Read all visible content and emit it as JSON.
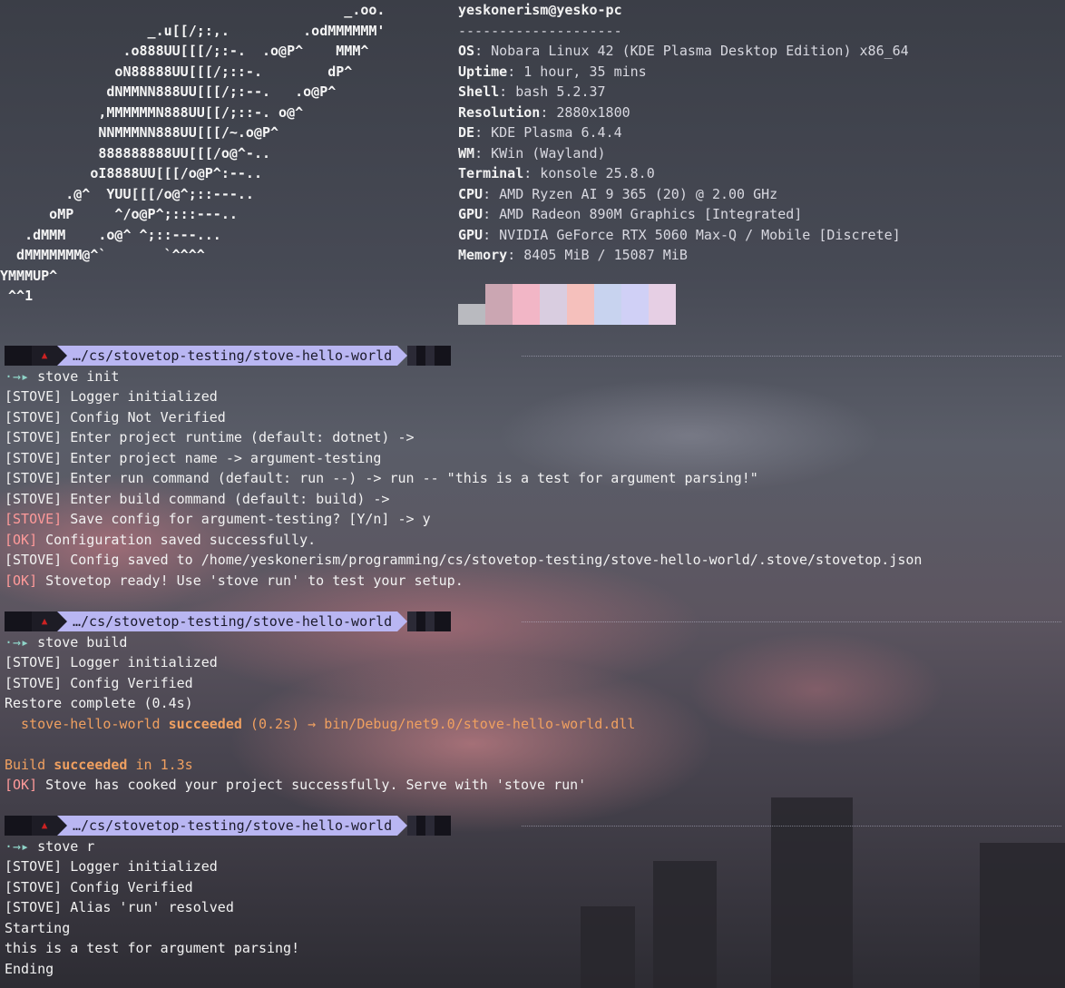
{
  "logo": [
    "                                          _.oo.",
    "                  _.u[[/;:,.         .odMMMMMM'",
    "               .o888UU[[[/;:-.  .o@P^    MMM^",
    "              oN88888UU[[[/;::-.        dP^",
    "             dNMMNN888UU[[[/;:--.   .o@P^",
    "            ,MMMMMMN888UU[[/;::-. o@^",
    "            NNMMMNN888UU[[[/~.o@P^",
    "            888888888UU[[[/o@^-..",
    "           oI8888UU[[[/o@P^:--..",
    "        .@^  YUU[[[/o@^;::---..",
    "      oMP     ^/o@P^;:::---..",
    "   .dMMM    .o@^ ^;::---...",
    "  dMMMMMMM@^`       `^^^^",
    "YMMMUP^",
    " ^^1"
  ],
  "sysinfo": {
    "host": "yeskonerism@yesko-pc",
    "separator": "--------------------",
    "rows": [
      {
        "key": "OS",
        "value": ": Nobara Linux 42 (KDE Plasma Desktop Edition) x86_64"
      },
      {
        "key": "Uptime",
        "value": ": 1 hour, 35 mins"
      },
      {
        "key": "Shell",
        "value": ": bash 5.2.37"
      },
      {
        "key": "Resolution",
        "value": ": 2880x1800"
      },
      {
        "key": "DE",
        "value": ": KDE Plasma 6.4.4"
      },
      {
        "key": "WM",
        "value": ": KWin (Wayland)"
      },
      {
        "key": "Terminal",
        "value": ": konsole 25.8.0"
      },
      {
        "key": "CPU",
        "value": ": AMD Ryzen AI 9 365 (20) @ 2.00 GHz"
      },
      {
        "key": "GPU",
        "value": ": AMD Radeon 890M Graphics [Integrated]"
      },
      {
        "key": "GPU",
        "value": ": NVIDIA GeForce RTX 5060 Max-Q / Mobile [Discrete]"
      },
      {
        "key": "Memory",
        "value": ": 8405 MiB / 15087 MiB"
      }
    ],
    "palette": [
      "#b9babf",
      "#cba6b2",
      "#f2b6c6",
      "#d9cde0",
      "#f5c0bc",
      "#c8d3ef",
      "#d0d0f6",
      "#e6cfe4"
    ]
  },
  "prompt_path": "…/cs/stovetop-testing/stove-hello-world",
  "prompt_glyph": "·→▸",
  "blocks": [
    {
      "command": "stove init",
      "output": [
        {
          "text": "[STOVE] Logger initialized"
        },
        {
          "text": "[STOVE] Config Not Verified"
        },
        {
          "text": "[STOVE] Enter project runtime (default: dotnet) ->"
        },
        {
          "text": "[STOVE] Enter project name -> argument-testing"
        },
        {
          "text": "[STOVE] Enter run command (default: run --) -> run -- \"this is a test for argument parsing!\""
        },
        {
          "text": "[STOVE] Enter build command (default: build) ->"
        },
        {
          "tag": "[STOVE]",
          "text": " Save config for argument-testing? [Y/n] -> y",
          "tagClass": "ok"
        },
        {
          "tag": "[OK]",
          "text": " Configuration saved successfully.",
          "tagClass": "ok"
        },
        {
          "text": "[STOVE] Config saved to /home/yeskonerism/programming/cs/stovetop-testing/stove-hello-world/.stove/stovetop.json"
        },
        {
          "tag": "[OK]",
          "text": " Stovetop ready! Use 'stove run' to test your setup.",
          "tagClass": "ok"
        }
      ]
    },
    {
      "command": "stove build",
      "output": [
        {
          "text": "[STOVE] Logger initialized"
        },
        {
          "text": "[STOVE] Config Verified"
        },
        {
          "text": "Restore complete (0.4s)"
        },
        {
          "pre": "  stove-hello-world ",
          "bold": "succeeded",
          "text": " (0.2s) → bin/Debug/net9.0/stove-hello-world.dll"
        },
        {
          "text": ""
        },
        {
          "pre": "Build ",
          "bold": "succeeded",
          "text": " in 1.3s"
        },
        {
          "tag": "[OK]",
          "text": " Stove has cooked your project successfully. Serve with 'stove run'",
          "tagClass": "ok"
        }
      ]
    },
    {
      "command": "stove r",
      "output": [
        {
          "text": "[STOVE] Logger initialized"
        },
        {
          "text": "[STOVE] Config Verified"
        },
        {
          "text": "[STOVE] Alias 'run' resolved"
        },
        {
          "text": "Starting"
        },
        {
          "text": "this is a test for argument parsing!"
        },
        {
          "text": "Ending"
        }
      ]
    }
  ]
}
